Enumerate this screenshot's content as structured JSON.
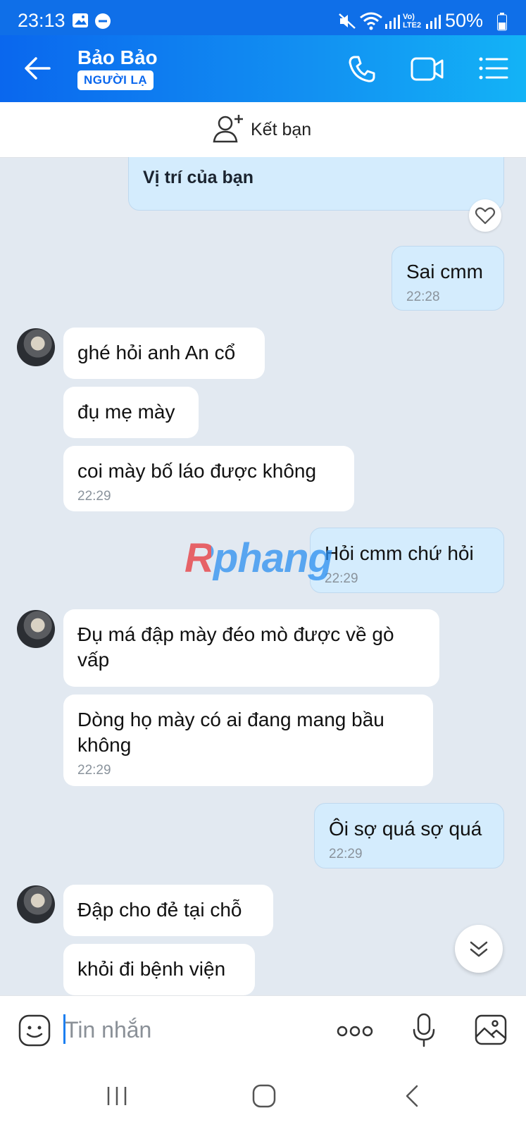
{
  "status_bar": {
    "time": "23:13",
    "battery": "50%"
  },
  "header": {
    "contact_name": "Bảo Bảo",
    "badge": "NGƯỜI LẠ"
  },
  "add_friend": {
    "label": "Kết bạn"
  },
  "messages": {
    "location_caption": "Vị trí của bạn",
    "m1": {
      "text": "Sai cmm",
      "time": "22:28"
    },
    "m2": {
      "text": "ghé hỏi anh An cổ"
    },
    "m3": {
      "text": "đụ mẹ mày"
    },
    "m4": {
      "text": "coi mày bố láo được không",
      "time": "22:29"
    },
    "m5": {
      "text": "Hỏi cmm chứ hỏi",
      "time": "22:29"
    },
    "m6": {
      "text": "Đụ má đập mày đéo mò được về gò vấp"
    },
    "m7": {
      "text": "Dòng họ mày có ai đang mang bầu không",
      "time": "22:29"
    },
    "m8": {
      "text": "Ôi sợ quá sợ quá",
      "time": "22:29"
    },
    "m9": {
      "text": "Đập cho đẻ tại chỗ"
    },
    "m10": {
      "text": "khỏi đi bệnh viện"
    }
  },
  "watermark": "Rphang",
  "input": {
    "placeholder": "Tin nhắn"
  },
  "colors": {
    "header_start": "#0a67ee",
    "header_end": "#13b3f6",
    "my_bubble": "#d4ecfd",
    "background": "#e2e9f1"
  }
}
